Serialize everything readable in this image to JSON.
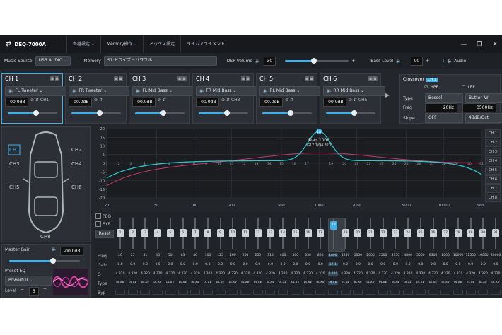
{
  "titlebar": {
    "app_title": "DEQ-7000A",
    "menu": [
      "各種設定",
      "Memory操作",
      "ミックス設定",
      "タイムアライメント"
    ],
    "window_controls": [
      "—",
      "❐",
      "✕"
    ]
  },
  "toolbar": {
    "music_source_label": "Music Source",
    "music_source_value": "USB AUDIO",
    "memory_label": "Memory",
    "memory_value": "S1:ドライズ－パワフル",
    "dsp_volume_label": "DSP Volume",
    "dsp_volume_value": "30",
    "dsp_volume_level": 0.45,
    "bass_level_label": "Bass Level",
    "bass_level_value": "00",
    "audio_label": "Audio"
  },
  "channels": [
    {
      "name": "CH 1",
      "speaker": "FL Tweeter",
      "gain": "-00.0dB",
      "phase": "CH1",
      "active": true
    },
    {
      "name": "CH 2",
      "speaker": "FR Tweeter",
      "gain": "-00.0dB",
      "phase": "",
      "active": false
    },
    {
      "name": "CH 3",
      "speaker": "FL Mid Bass",
      "gain": "-00.0dB",
      "phase": "",
      "active": false
    },
    {
      "name": "CH 4",
      "speaker": "FR Mid Bass",
      "gain": "-00.0dB",
      "phase": "CH3",
      "active": false
    },
    {
      "name": "CH 5",
      "speaker": "RL Mid Bass",
      "gain": "-00.0dB",
      "phase": "",
      "active": false
    },
    {
      "name": "CH 6",
      "speaker": "RR Mid Bass",
      "gain": "-00.0dB",
      "phase": "CH5",
      "active": false
    }
  ],
  "crossover": {
    "title": "Crossover",
    "badge": "CH 1",
    "hpf_label": "HPF",
    "lpf_label": "LPF",
    "type_label": "Type",
    "type_value": "Bessel",
    "type_value2": "Butter_W",
    "freq_label": "Freq",
    "freq_value": "20Hz",
    "freq_value2": "3500Hz",
    "slope_label": "Slope",
    "slope_value": "OFF",
    "slope_value2": "48dB/Oct"
  },
  "car_channels": [
    "CH1",
    "CH2",
    "CH3",
    "CH4",
    "CH5",
    "CH6",
    "CH8"
  ],
  "master": {
    "gain_label": "Master Gain",
    "gain_value": "-00.0dB",
    "preset_label": "Preset EQ",
    "preset_value": "Powerfull",
    "level_label": "Level",
    "level_value": "5"
  },
  "graph": {
    "y_ticks": [
      "20",
      "15",
      "10",
      "5",
      "0",
      "-5",
      "-10",
      "-15",
      "-20"
    ],
    "x_ticks": [
      "20",
      "50",
      "100",
      "200",
      "500",
      "1000",
      "2000",
      "5000",
      "10000",
      "20000"
    ],
    "marker_band": "18",
    "tooltip_line1": "Freq 1000",
    "tooltip_line2": "G17.1/Q4.320",
    "legend": [
      "CH 1",
      "CH 2",
      "CH 3",
      "CH 4",
      "CH 5",
      "CH 6",
      "CH 7",
      "CH 8"
    ],
    "colors": {
      "ch1": "#2ec4c9",
      "ch3": "#c23a6b"
    }
  },
  "eq": {
    "peq_label": "PEQ",
    "byp_label": "BYP",
    "reset_label": "Reset",
    "row_labels": [
      "Freq",
      "Gain",
      "Q",
      "Type",
      "Byp"
    ],
    "bands": [
      "1",
      "2",
      "3",
      "4",
      "5",
      "6",
      "7",
      "8",
      "9",
      "10",
      "11",
      "12",
      "13",
      "14",
      "15",
      "16",
      "17",
      "18",
      "19",
      "20",
      "21",
      "22",
      "23",
      "24",
      "25",
      "26",
      "27",
      "28",
      "29",
      "30",
      "31"
    ],
    "freqs": [
      "20",
      "25",
      "31",
      "40",
      "50",
      "63",
      "80",
      "100",
      "125",
      "160",
      "200",
      "250",
      "315",
      "400",
      "500",
      "630",
      "800",
      "1000",
      "1250",
      "1600",
      "2000",
      "2500",
      "3150",
      "4000",
      "5000",
      "6300",
      "8000",
      "10000",
      "12500",
      "16000",
      "20000"
    ],
    "gain_value": "0.0",
    "selected_gain": "17.1",
    "q_value": "4.320",
    "type_value": "PEAK",
    "selected_band_index": 17
  }
}
